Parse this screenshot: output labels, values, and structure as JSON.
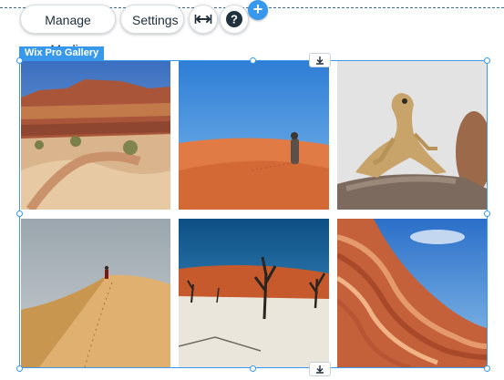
{
  "toolbar": {
    "manage_media_label": "Manage Media",
    "settings_label": "Settings",
    "stretch_icon": "arrows-horizontal-icon",
    "help_icon": "question-icon",
    "help_glyph": "?",
    "add_icon": "plus-icon",
    "add_glyph": "+"
  },
  "gallery": {
    "label": "Wix Pro Gallery",
    "stretch_handle_icon": "download-arrow-icon",
    "images": [
      {
        "subject": "desert canyon with dirt road"
      },
      {
        "subject": "person walking on red sand dune"
      },
      {
        "subject": "lizard on a rock"
      },
      {
        "subject": "hiker on sand dune ridge"
      },
      {
        "subject": "dead trees in salt pan"
      },
      {
        "subject": "striped sandstone wave rock"
      }
    ]
  },
  "colors": {
    "accent": "#3899ec",
    "dashed_guide": "#3b6e96"
  }
}
